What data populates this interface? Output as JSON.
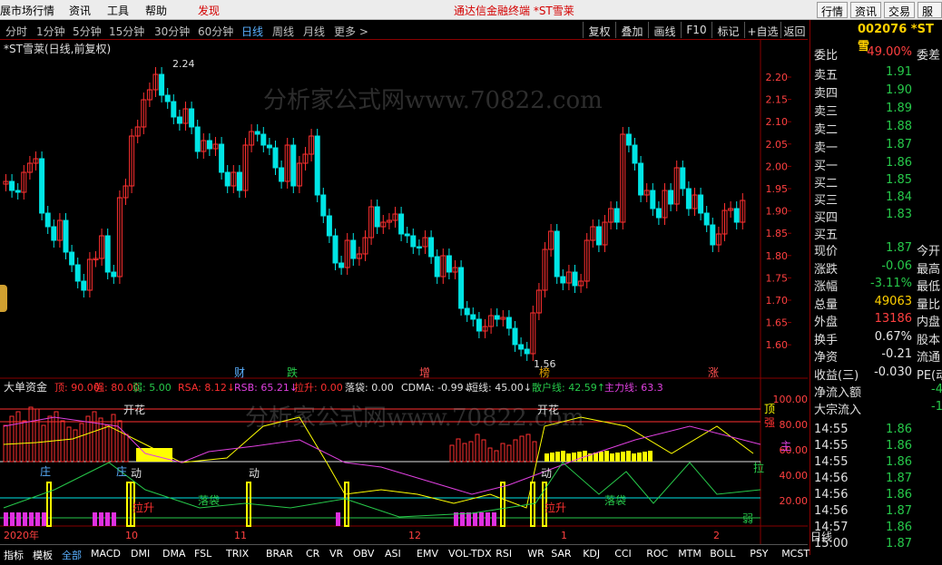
{
  "menu": {
    "items": [
      "展市场行情",
      "资讯",
      "工具",
      "帮助",
      "发现"
    ],
    "center_title": "通达信金融终端  *ST雪莱",
    "right_buttons": [
      "行情",
      "资讯",
      "交易",
      "服"
    ]
  },
  "periods": {
    "items": [
      "分时",
      "1分钟",
      "5分钟",
      "15分钟",
      "30分钟",
      "60分钟",
      "日线",
      "周线",
      "月线",
      "更多 >"
    ],
    "active": "日线",
    "tools": [
      "复权",
      "叠加",
      "画线",
      "F10",
      "标记",
      "+自选",
      "返回"
    ]
  },
  "main_chart": {
    "title": "*ST雪莱(日线,前复权)",
    "high_label": "2.24",
    "low_label": "1.56",
    "y_ticks": [
      "2.20",
      "2.15",
      "2.10",
      "2.05",
      "2.00",
      "1.95",
      "1.90",
      "1.85",
      "1.80",
      "1.75",
      "1.70",
      "1.65",
      "1.60"
    ],
    "markers": [
      "财",
      "跌",
      "增",
      "榜",
      "涨"
    ],
    "watermark": "分析家公式网www.70822.com"
  },
  "indicator": {
    "name": "大单资金",
    "items": [
      {
        "label": "顶: 90.00",
        "color": "#ff3030"
      },
      {
        "label": "强: 80.00",
        "color": "#ff3030"
      },
      {
        "label": "弱: 5.00",
        "color": "#27c94a"
      },
      {
        "label": "RSA: 8.12↓",
        "color": "#ff3030"
      },
      {
        "label": "RSB: 65.21↓",
        "color": "#e040e0"
      },
      {
        "label": "拉升: 0.00",
        "color": "#ff3030"
      },
      {
        "label": "落袋: 0.00",
        "color": "#e0e0e0"
      },
      {
        "label": "CDMA: -0.99↓",
        "color": "#e0e0e0"
      },
      {
        "label": "短线: 45.00↓",
        "color": "#e0e0e0"
      },
      {
        "label": "散户线: 42.59↑",
        "color": "#27c94a"
      },
      {
        "label": "主力线: 63.3",
        "color": "#e040e0"
      }
    ],
    "y_ticks": [
      "100.00",
      "80.00",
      "60.00",
      "40.00",
      "20.00"
    ],
    "right_labels": [
      "顶",
      "强",
      "主",
      "拉",
      "弱"
    ],
    "annotations": [
      "开花",
      "开花",
      "动",
      "动",
      "庄",
      "庄",
      "动",
      "拉升",
      "拉升",
      "落袋",
      "落袋"
    ],
    "watermark": "分析家公式网www.70822.com"
  },
  "time_axis": {
    "labels": [
      "2020年",
      "10",
      "11",
      "12",
      "1",
      "2"
    ],
    "period": "日线"
  },
  "quote": {
    "code": "002076 *ST雪",
    "weibi_label": "委比",
    "weibi_value": "49.00%",
    "weicha_label": "委差",
    "asks": [
      {
        "label": "卖五",
        "price": "1.91"
      },
      {
        "label": "卖四",
        "price": "1.90"
      },
      {
        "label": "卖三",
        "price": "1.89"
      },
      {
        "label": "卖二",
        "price": "1.88"
      },
      {
        "label": "卖一",
        "price": "1.87"
      }
    ],
    "bids": [
      {
        "label": "买一",
        "price": "1.86"
      },
      {
        "label": "买二",
        "price": "1.85"
      },
      {
        "label": "买三",
        "price": "1.84"
      },
      {
        "label": "买四",
        "price": "1.83"
      },
      {
        "label": "买五",
        "price": ""
      }
    ],
    "stats": [
      {
        "label": "现价",
        "value": "1.87",
        "tail": "今开"
      },
      {
        "label": "涨跌",
        "value": "-0.06",
        "tail": "最高"
      },
      {
        "label": "涨幅",
        "value": "-3.11%",
        "tail": "最低"
      },
      {
        "label": "总量",
        "value": "49063",
        "tail": "量比"
      },
      {
        "label": "外盘",
        "value": "13186",
        "tail": "内盘"
      },
      {
        "label": "换手",
        "value": "0.67%",
        "tail": "股本"
      },
      {
        "label": "净资",
        "value": "-0.21",
        "tail": "流通"
      },
      {
        "label": "收益(三)",
        "value": "-0.030",
        "tail": "PE(动"
      }
    ],
    "flow": [
      {
        "label": "净流入额",
        "value": "-4"
      },
      {
        "label": "大宗流入",
        "value": "-1"
      }
    ],
    "ticks": [
      {
        "time": "14:55",
        "price": "1.86"
      },
      {
        "time": "14:55",
        "price": "1.86"
      },
      {
        "time": "14:55",
        "price": "1.86"
      },
      {
        "time": "14:56",
        "price": "1.87"
      },
      {
        "time": "14:56",
        "price": "1.86"
      },
      {
        "time": "14:56",
        "price": "1.87"
      },
      {
        "time": "14:57",
        "price": "1.86"
      },
      {
        "time": "15:00",
        "price": "1.87"
      }
    ]
  },
  "bottom_tabs": [
    "指标",
    "模板",
    "全部",
    "MACD",
    "DMI",
    "DMA",
    "FSL",
    "TRIX",
    "BRAR",
    "CR",
    "VR",
    "OBV",
    "ASI",
    "EMV",
    "VOL-TDX",
    "RSI",
    "WR",
    "SAR",
    "KDJ",
    "CCI",
    "ROC",
    "MTM",
    "BOLL",
    "PSY",
    "MCST"
  ],
  "bottom_selected": "全部",
  "colors": {
    "up": "#ff3030",
    "down": "#00e5e5",
    "panel_border": "#800000",
    "green": "#27c94a",
    "yellow": "#ffff00",
    "magenta": "#e040e0"
  }
}
